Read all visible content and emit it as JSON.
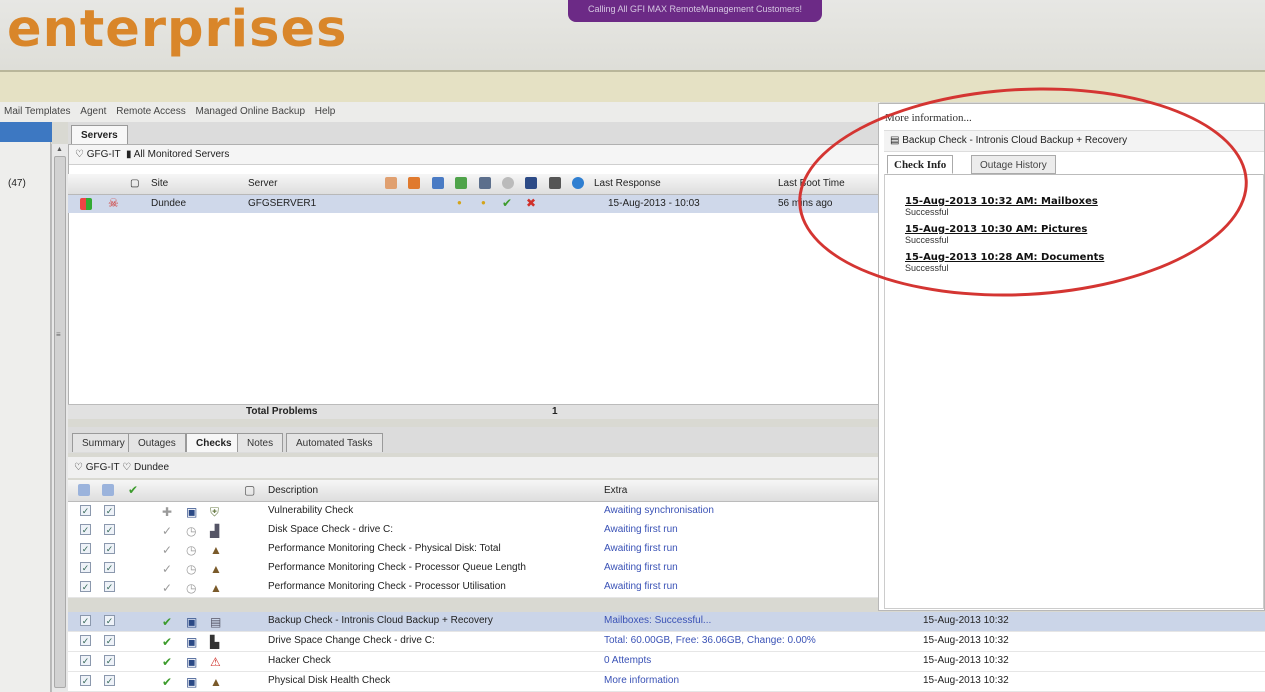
{
  "header": {
    "logo_text": "enterprises",
    "promo": "Calling All GFI MAX RemoteManagement Customers!"
  },
  "menu": [
    "Mail Templates",
    "Agent",
    "Remote Access",
    "Managed Online Backup",
    "Help"
  ],
  "left_nav": {
    "count_label": "(47)"
  },
  "servers_tab": "Servers",
  "servers_breadcrumb": {
    "client": "GFG-IT",
    "filter": "All Monitored Servers"
  },
  "server_columns": {
    "site": "Site",
    "server": "Server",
    "last_response": "Last Response",
    "last_boot": "Last Boot Time"
  },
  "server_rows": [
    {
      "site": "Dundee",
      "server": "GFGSERVER1",
      "last_response": "15-Aug-2013 - 10:03",
      "last_boot": "56 mins ago"
    }
  ],
  "total_problems": {
    "label": "Total Problems",
    "value": "1"
  },
  "detail_tabs": [
    "Summary",
    "Outages",
    "Checks",
    "Notes",
    "Automated Tasks"
  ],
  "detail_active_tab": "Checks",
  "checks_breadcrumb": {
    "client": "GFG-IT",
    "site": "Dundee"
  },
  "check_columns": {
    "description": "Description",
    "extra": "Extra"
  },
  "checks": [
    {
      "description": "Vulnerability Check",
      "extra": "Awaiting synchronisation",
      "time": ""
    },
    {
      "description": "Disk Space Check - drive C:",
      "extra": "Awaiting first run",
      "time": ""
    },
    {
      "description": "Performance Monitoring Check - Physical Disk: Total",
      "extra": "Awaiting first run",
      "time": ""
    },
    {
      "description": "Performance Monitoring Check - Processor Queue Length",
      "extra": "Awaiting first run",
      "time": ""
    },
    {
      "description": "Performance Monitoring Check - Processor Utilisation",
      "extra": "Awaiting first run",
      "time": ""
    },
    {
      "description": "Backup Check - Intronis Cloud Backup + Recovery",
      "extra": "Mailboxes: Successful...",
      "time": "15-Aug-2013 10:32"
    },
    {
      "description": "Drive Space Change Check - drive C:",
      "extra": "Total: 60.00GB, Free: 36.06GB, Change: 0.00%",
      "time": "15-Aug-2013 10:32"
    },
    {
      "description": "Hacker Check",
      "extra": "0 Attempts",
      "time": "15-Aug-2013 10:32"
    },
    {
      "description": "Physical Disk Health Check",
      "extra": "More information",
      "time": "15-Aug-2013 10:32"
    }
  ],
  "info_panel": {
    "heading": "More information...",
    "subtitle": "Backup Check - Intronis Cloud Backup + Recovery",
    "tabs": [
      "Check Info",
      "Outage History"
    ],
    "entries": [
      {
        "date": "15-Aug-2013 10:32 AM: Mailboxes",
        "status": "Successful"
      },
      {
        "date": "15-Aug-2013 10:30 AM: Pictures",
        "status": "Successful"
      },
      {
        "date": "15-Aug-2013 10:28 AM: Documents",
        "status": "Successful"
      }
    ]
  },
  "colors": {
    "logo": "#d9862a",
    "promo_bg": "#6c2a86",
    "selected_row": "#cfd8ea",
    "link": "#3a52b6",
    "annotation": "#d43532"
  }
}
